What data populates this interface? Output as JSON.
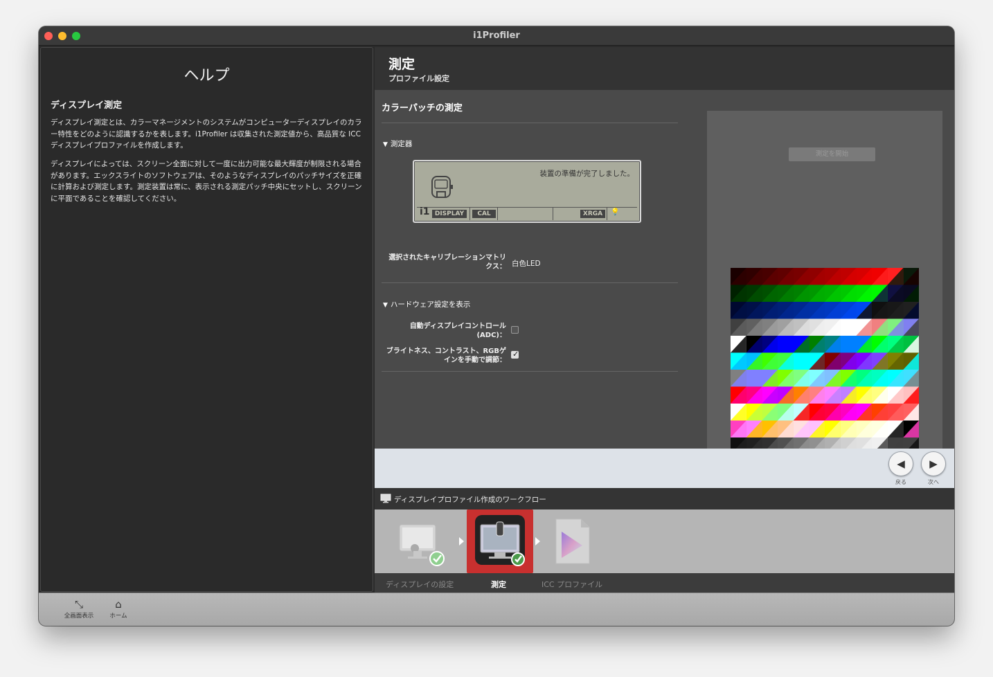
{
  "window": {
    "title": "i1Profiler"
  },
  "help": {
    "heading": "ヘルプ",
    "section_title": "ディスプレイ測定",
    "para1": "ディスプレイ測定とは、カラーマネージメントのシステムがコンピューターディスプレイのカラー特性をどのように認識するかを表します。i1Profiler は収集された測定値から、高品質な ICC ディスプレイプロファイルを作成します。",
    "para2": "ディスプレイによっては、スクリーン全面に対して一度に出力可能な最大輝度が制限される場合があります。エックスライトのソフトウェアは、そのようなディスプレイのパッチサイズを正確に計算および測定します。測定装置は常に、表示される測定パッチ中央にセットし、スクリーンに平面であることを確認してください。"
  },
  "main": {
    "title": "測定",
    "subtitle": "プロファイル設定"
  },
  "measure": {
    "section_title": "カラーパッチの測定",
    "device_disclosure": "測定器",
    "lcd_message": "装置の準備が完了しました。",
    "lcd_i1": "i1",
    "lcd_display": "DISPLAY",
    "lcd_cal": "CAL",
    "lcd_xrga": "XRGA",
    "calib_label_1": "選択されたキャリブレーションマトリ",
    "calib_label_2": "クス：",
    "calib_value": "白色LED",
    "hw_disclosure": "ハードウェア設定を表示",
    "adc_label_1": "自動ディスプレイコントロール",
    "adc_label_2": "(ADC)：",
    "adc_checked": false,
    "manual_label_1": "ブライトネス、コントラスト、RGBゲ",
    "manual_label_2": "インを手動で調節：",
    "manual_checked": true,
    "start_button": "測定を開始"
  },
  "nav": {
    "back_icon": "◀",
    "back_label": "戻る",
    "next_icon": "▶",
    "next_label": "次へ"
  },
  "workflow": {
    "title": "ディスプレイプロファイル作成のワークフロー",
    "steps": [
      {
        "label": "ディスプレイの設定",
        "active": false
      },
      {
        "label": "測定",
        "active": true
      },
      {
        "label": "ICC プロファイル",
        "active": false
      }
    ]
  },
  "toolbar": {
    "fullscreen_label": "全画面表示",
    "home_label": "ホーム"
  },
  "colors": {
    "accent_step": "#c8302f"
  }
}
